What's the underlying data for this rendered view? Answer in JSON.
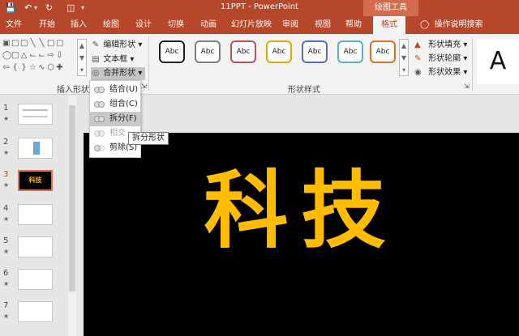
{
  "window": {
    "title": "11PPT - PowerPoint",
    "context_tool": "绘图工具"
  },
  "quick_access": {
    "save_icon": "save-icon",
    "undo_icon": "undo-icon",
    "redo_icon": "redo-icon",
    "start_icon": "start-from-beginning-icon"
  },
  "tabs": [
    {
      "label": "文件"
    },
    {
      "label": "开始"
    },
    {
      "label": "插入"
    },
    {
      "label": "绘图"
    },
    {
      "label": "设计"
    },
    {
      "label": "切换"
    },
    {
      "label": "动画"
    },
    {
      "label": "幻灯片放映"
    },
    {
      "label": "审阅"
    },
    {
      "label": "视图"
    },
    {
      "label": "帮助"
    },
    {
      "label": "格式"
    }
  ],
  "tell_me": "操作说明搜索",
  "ribbon": {
    "insert_shapes": {
      "group_label": "插入形状",
      "edit_shape": "编辑形状",
      "text_box": "文本框",
      "merge_shapes": "合并形状"
    },
    "shape_styles": {
      "group_label": "形状样式",
      "swatches": [
        {
          "label": "Abc",
          "color": "#222222"
        },
        {
          "label": "Abc",
          "color": "#7f7f7f"
        },
        {
          "label": "Abc",
          "color": "#c0504d"
        },
        {
          "label": "Abc",
          "color": "#e0a800"
        },
        {
          "label": "Abc",
          "color": "#4a6ec9"
        },
        {
          "label": "Abc",
          "color": "#58b0c8"
        },
        {
          "label": "Abc",
          "color": "#e07020"
        }
      ],
      "fill": "形状填充",
      "outline": "形状轮廓",
      "effects": "形状效果"
    },
    "wordart_letter": "A"
  },
  "merge_menu": {
    "items": [
      {
        "label": "结合(U)",
        "disabled": false
      },
      {
        "label": "组合(C)",
        "disabled": false
      },
      {
        "label": "拆分(F)",
        "disabled": false
      },
      {
        "label": "相交",
        "disabled": true
      },
      {
        "label": "剪除(S)",
        "disabled": false
      }
    ],
    "tooltip": "拆分形状"
  },
  "slides": [
    {
      "number": "1"
    },
    {
      "number": "2"
    },
    {
      "number": "3",
      "text": "科技"
    },
    {
      "number": "4"
    },
    {
      "number": "5"
    },
    {
      "number": "6"
    },
    {
      "number": "7"
    }
  ],
  "slide": {
    "text": "科技",
    "text_color": "#ffbc00",
    "background": "#000000"
  },
  "theme": {
    "accent": "#b7472a"
  }
}
